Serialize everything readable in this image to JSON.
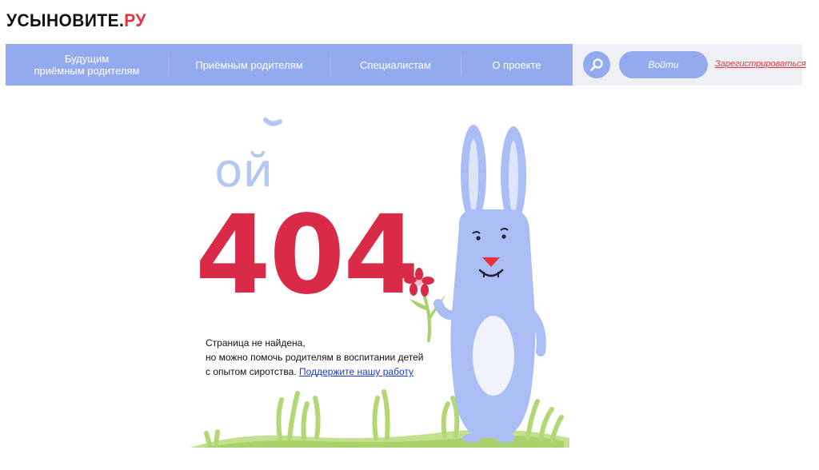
{
  "logo": {
    "main": "УСЫНОВИТЕ.",
    "accent": "РУ"
  },
  "nav": {
    "items": [
      {
        "label": "Будущим\nприёмным родителям"
      },
      {
        "label": "Приёмным родителям"
      },
      {
        "label": "Специалистам"
      },
      {
        "label": "О проекте"
      }
    ],
    "login_label": "Войти",
    "register_label": "Зарегистрироваться",
    "search_icon": "search-icon"
  },
  "error": {
    "oops": "ой",
    "code": "404",
    "line1": "Страница не найдена,",
    "line2": "но можно помочь родителям в воспитании детей",
    "line3": "с опытом сиротства.",
    "support_link": "Поддержите нашу работу"
  },
  "colors": {
    "accent_red": "#e8323c",
    "nav_blue": "#93aaef",
    "bunny_blue": "#aabdf4",
    "digits_red": "#d92a48",
    "grass_green": "#a8d36b",
    "link_blue": "#1a39d8"
  }
}
